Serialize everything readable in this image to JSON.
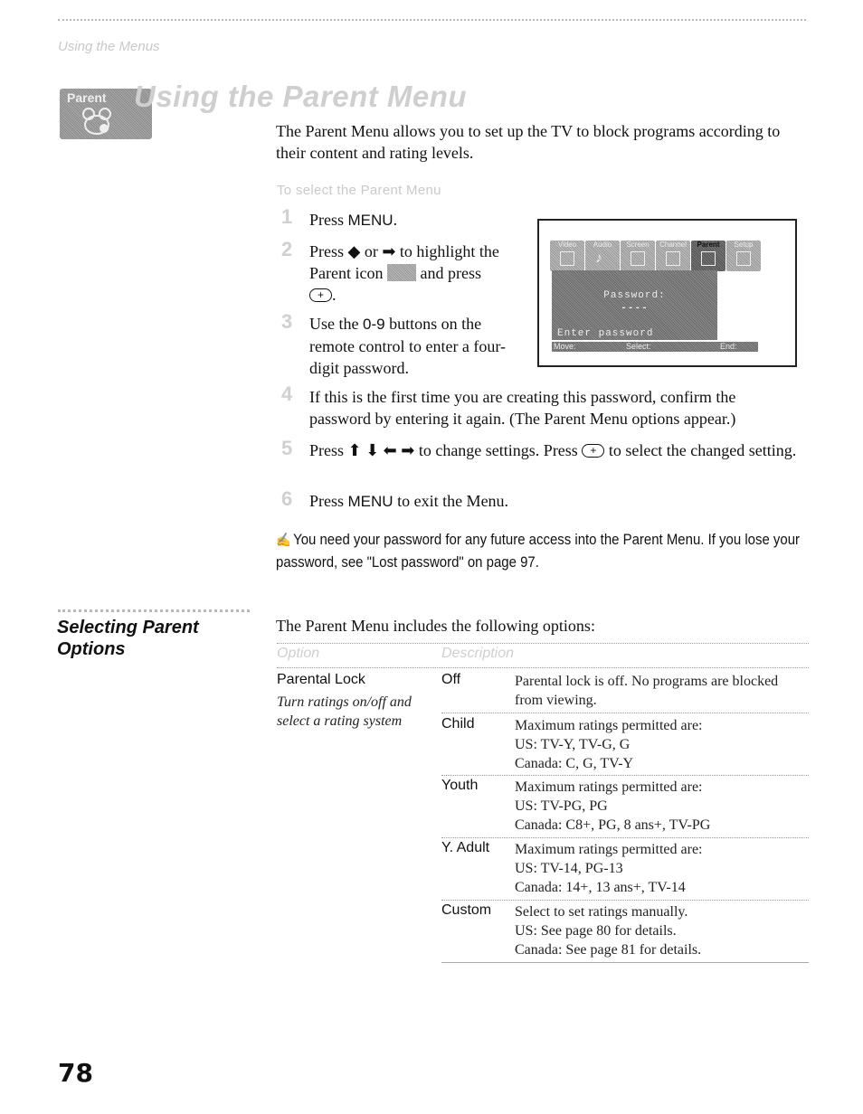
{
  "running_head": "Using the Menus",
  "section1": {
    "badge_label": "Parent",
    "title": "Using the Parent Menu",
    "intro": "The Parent Menu allows you to set up the TV to block programs according to their content and rating levels.",
    "subhead": "To select the Parent Menu",
    "steps": [
      {
        "num": "1",
        "pre": "Press ",
        "key": "MENU",
        "post": "."
      },
      {
        "num": "2",
        "line1": "Press ◆ or ➡ to highlight the",
        "line2a": "Parent icon",
        "line2b": "and press",
        "button": "+",
        "tail": "."
      },
      {
        "num": "3",
        "pre": "Use the ",
        "key": "0-9",
        "post": " buttons on the remote control to enter a four-digit password."
      },
      {
        "num": "4",
        "text": "If this is the first time you are creating this password, confirm the password by entering it again. (The Parent Menu options appear.)"
      },
      {
        "num": "5",
        "pre": "Press ⬆ ⬇ ⬅ ➡ to change settings. Press",
        "button": "+",
        "post": "to select the changed setting."
      },
      {
        "num": "6",
        "pre": "Press ",
        "key": "MENU",
        "post": " to exit the Menu."
      }
    ],
    "tv_screen": {
      "tabs": [
        "Video",
        "Audio",
        "Screen",
        "Channel",
        "Parent",
        "Setup"
      ],
      "selected_tab": "Parent",
      "password_label": "Password:",
      "password_value": "----",
      "prompt": "Enter password",
      "status_move": "Move:",
      "status_select": "Select:",
      "status_end": "End:"
    },
    "note": "You need your password for any future access into the Parent Menu. If you lose your password, see \"Lost password\" on page 97."
  },
  "section2": {
    "heading_line1": "Selecting Parent",
    "heading_line2": "Options",
    "intro": "The Parent Menu includes the following options:",
    "table": {
      "headers": [
        "Option",
        "Description"
      ],
      "option_name": "Parental Lock",
      "option_desc_line1": "Turn ratings on/off and",
      "option_desc_line2": "select a rating system",
      "rows": [
        {
          "value": "Off",
          "lines": [
            "Parental lock is off. No programs are blocked",
            "from viewing."
          ]
        },
        {
          "value": "Child",
          "lines": [
            "Maximum ratings permitted are:",
            "US: TV-Y, TV-G, G",
            "Canada: C, G, TV-Y"
          ]
        },
        {
          "value": "Youth",
          "lines": [
            "Maximum ratings permitted are:",
            "US: TV-PG, PG",
            "Canada: C8+, PG, 8 ans+, TV-PG"
          ]
        },
        {
          "value": "Y. Adult",
          "lines": [
            "Maximum ratings permitted are:",
            "US: TV-14, PG-13",
            "Canada: 14+, 13 ans+, TV-14"
          ]
        },
        {
          "value": "Custom",
          "lines": [
            "Select to set ratings manually.",
            "US: See page 80 for details.",
            "Canada: See page 81 for details."
          ]
        }
      ]
    }
  },
  "page_number": "78"
}
